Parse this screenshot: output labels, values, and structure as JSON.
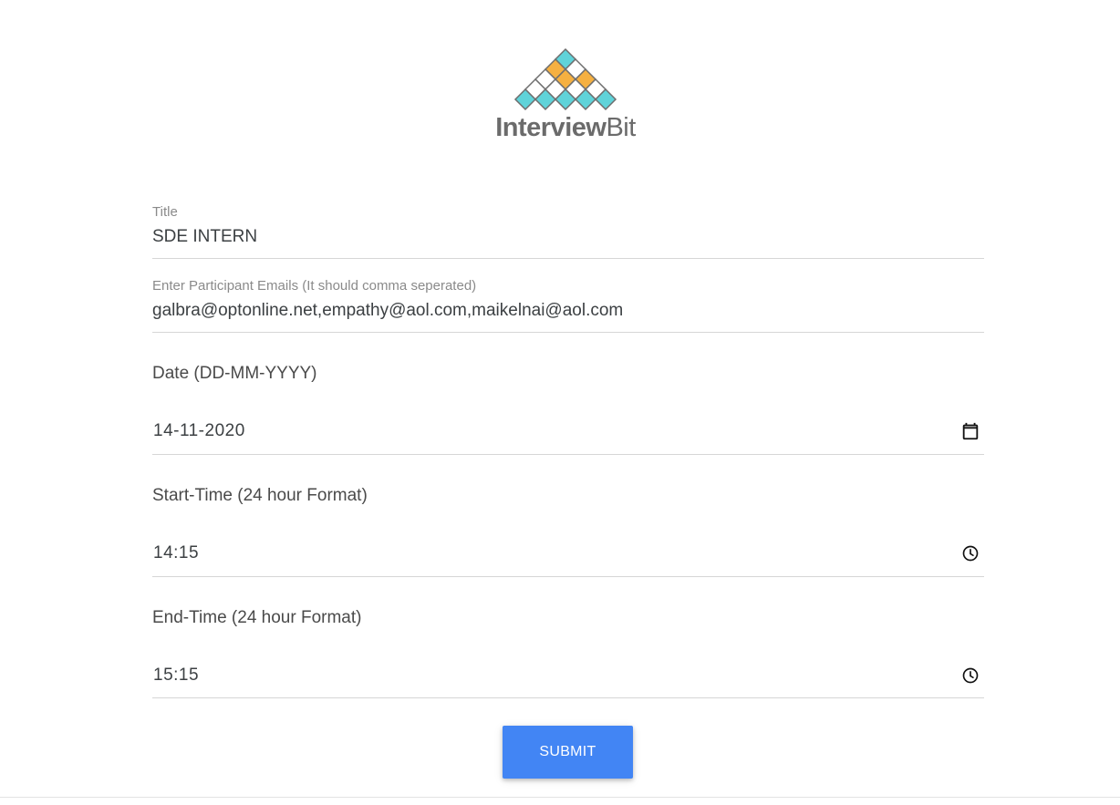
{
  "brand": {
    "name_bold": "Interview",
    "name_light": "Bit",
    "colors": {
      "teal": "#5fd3d9",
      "orange": "#f5b041",
      "outline": "#6e6e6e"
    }
  },
  "form": {
    "title_field": {
      "label": "Title",
      "value": "SDE INTERN"
    },
    "emails_field": {
      "label": "Enter Participant Emails (It should comma seperated)",
      "value": "galbra@optonline.net,empathy@aol.com,maikelnai@aol.com"
    },
    "date_field": {
      "label": "Date (DD-MM-YYYY)",
      "value": "14-11-2020",
      "icon": "calendar-icon"
    },
    "start_field": {
      "label": "Start-Time (24 hour Format)",
      "value": "14:15",
      "icon": "clock-icon"
    },
    "end_field": {
      "label": "End-Time (24 hour Format)",
      "value": "15:15",
      "icon": "clock-icon"
    },
    "submit_label": "SUBMIT",
    "accent": "#4285f4"
  }
}
